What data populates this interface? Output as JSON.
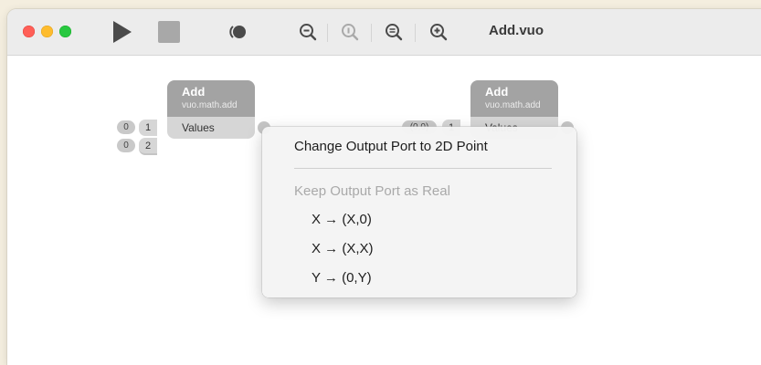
{
  "window": {
    "title": "Add.vuo",
    "toolbar": {
      "run_icon": "play-icon",
      "stop_icon": "stop-icon",
      "show_events_icon": "show-events-icon",
      "zoom_out_icon": "zoom-out-icon",
      "zoom_actual_icon": "zoom-actual-icon",
      "zoom_to_fit_icon": "zoom-to-fit-icon",
      "zoom_in_icon": "zoom-in-icon"
    }
  },
  "nodes": [
    {
      "title": "Add",
      "class_name": "vuo.math.add",
      "port_label": "Values",
      "list_items": [
        "1",
        "2"
      ],
      "constants": [
        "0",
        "0"
      ]
    },
    {
      "title": "Add",
      "class_name": "vuo.math.add",
      "port_label": "Values",
      "list_items": [
        "1"
      ],
      "constants": [
        "(0,0)"
      ]
    }
  ],
  "context_menu": {
    "items": [
      {
        "label": "Change Output Port to 2D Point",
        "enabled": true
      },
      {
        "label": "Keep Output Port as Real",
        "enabled": false
      },
      {
        "label": "X → (X,0)",
        "enabled": true
      },
      {
        "label": "X → (X,X)",
        "enabled": true
      },
      {
        "label": "Y → (0,Y)",
        "enabled": true
      }
    ]
  }
}
